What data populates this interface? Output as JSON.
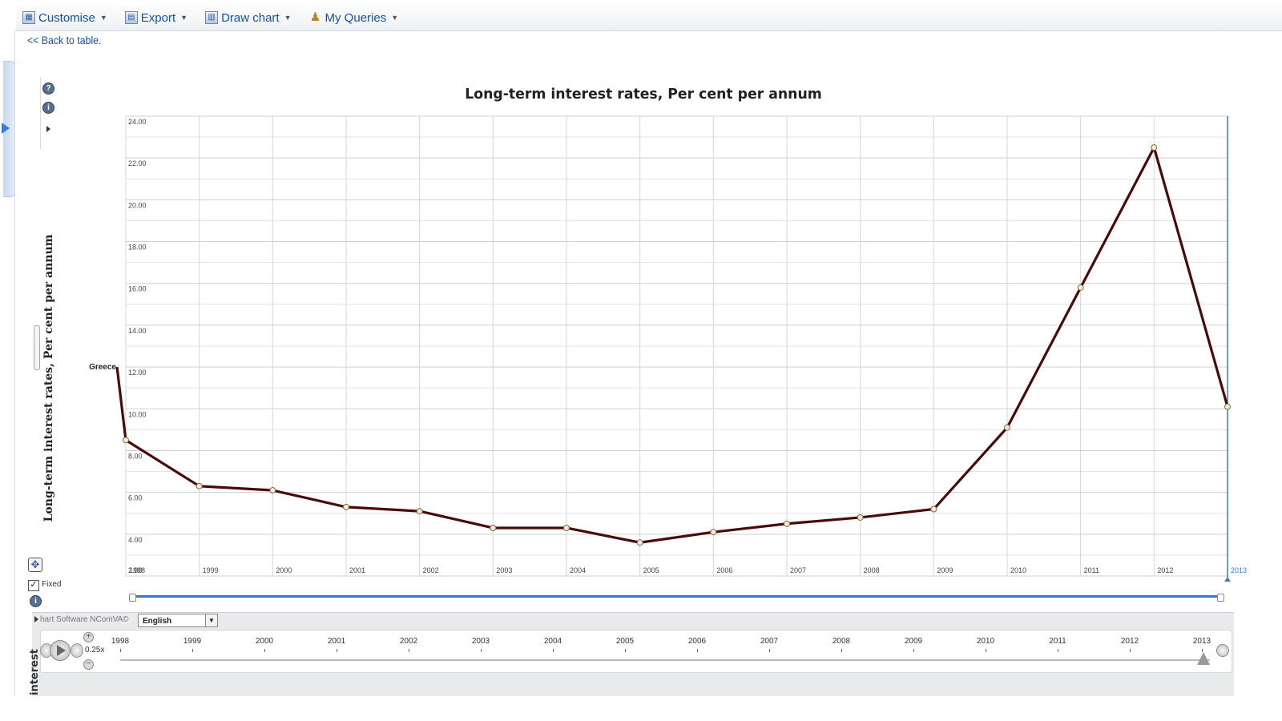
{
  "toolbar": {
    "items": [
      {
        "label": "Customise",
        "icon": "table-edit-icon"
      },
      {
        "label": "Export",
        "icon": "export-icon"
      },
      {
        "label": "Draw chart",
        "icon": "chart-icon"
      },
      {
        "label": "My Queries",
        "icon": "user-icon"
      }
    ]
  },
  "back_link": "<< Back to table.",
  "side_tools": {
    "help": "?",
    "info": "i",
    "fixed_label": "Fixed"
  },
  "footer": {
    "credit": "hart Software NComVA©",
    "language": "English"
  },
  "timeline": {
    "speed": "0.25x",
    "years": [
      "1998",
      "1999",
      "2000",
      "2001",
      "2002",
      "2003",
      "2004",
      "2005",
      "2006",
      "2007",
      "2008",
      "2009",
      "2010",
      "2011",
      "2012",
      "2013"
    ],
    "vertical_label": "interest"
  },
  "colors": {
    "line": "#4a0a0a",
    "marker_fill": "#f3ecd0",
    "accent": "#3a7ac8",
    "link": "#1a4f9c"
  },
  "chart_data": {
    "type": "line",
    "title": "Long-term interest rates, Per cent per annum",
    "ylabel": "Long-term interest rates, Per cent per annum",
    "xlabel": "",
    "categories": [
      "1998",
      "1999",
      "2000",
      "2001",
      "2002",
      "2003",
      "2004",
      "2005",
      "2006",
      "2007",
      "2008",
      "2009",
      "2010",
      "2011",
      "2012",
      "2013"
    ],
    "series": [
      {
        "name": "Greece",
        "values": [
          8.5,
          6.3,
          6.1,
          5.3,
          5.1,
          4.3,
          4.3,
          3.6,
          4.1,
          4.5,
          4.8,
          5.2,
          9.1,
          15.8,
          22.5,
          10.1
        ]
      }
    ],
    "label_value": 12.0,
    "ylim": [
      2,
      24
    ],
    "yticks": [
      "2.00",
      "4.00",
      "6.00",
      "8.00",
      "10.00",
      "12.00",
      "14.00",
      "16.00",
      "18.00",
      "20.00",
      "22.00",
      "24.00"
    ],
    "grid": true,
    "legend": "inline-left"
  }
}
